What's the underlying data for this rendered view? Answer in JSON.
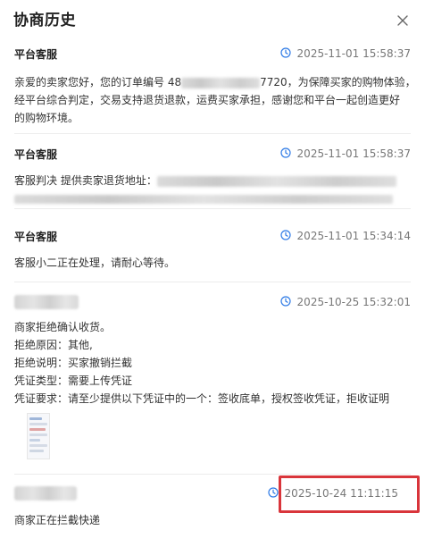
{
  "dialog": {
    "title": "协商历史",
    "close_icon": "close-icon"
  },
  "colors": {
    "clock_icon": "#2f7be6",
    "highlight": "#d9353b"
  },
  "records": [
    {
      "sender": "平台客服",
      "time": "2025-11-01 15:58:37",
      "lines": [
        {
          "prefix": "亲爱的卖家您好，您的订单编号 48",
          "suffix": "7720，为保障买家的购物体验，"
        },
        {
          "text": "经平台综合判定，交易支持退货退款，运费买家承担，感谢您和平台一起创造更好"
        },
        {
          "text": "的购物环境。"
        }
      ]
    },
    {
      "sender": "平台客服",
      "time": "2025-11-01 15:58:37",
      "lines": [
        {
          "prefix": "客服判决 提供卖家退货地址："
        }
      ]
    },
    {
      "sender": "平台客服",
      "time": "2025-11-01 15:34:14",
      "lines": [
        {
          "text": "客服小二正在处理，请耐心等待。"
        }
      ]
    },
    {
      "sender": "",
      "time": "2025-10-25 15:32:01",
      "lines": [
        {
          "text": "商家拒绝确认收货。"
        },
        {
          "text": "拒绝原因：其他,"
        },
        {
          "text": "拒绝说明：买家撤销拦截"
        },
        {
          "text": "凭证类型：需要上传凭证"
        },
        {
          "text": "凭证要求：请至少提供以下凭证中的一个：签收底单，授权签收凭证，拒收证明"
        }
      ]
    },
    {
      "sender": "",
      "time": "2025-10-24 11:11:15",
      "lines": [
        {
          "text": "商家正在拦截快递"
        }
      ]
    }
  ]
}
